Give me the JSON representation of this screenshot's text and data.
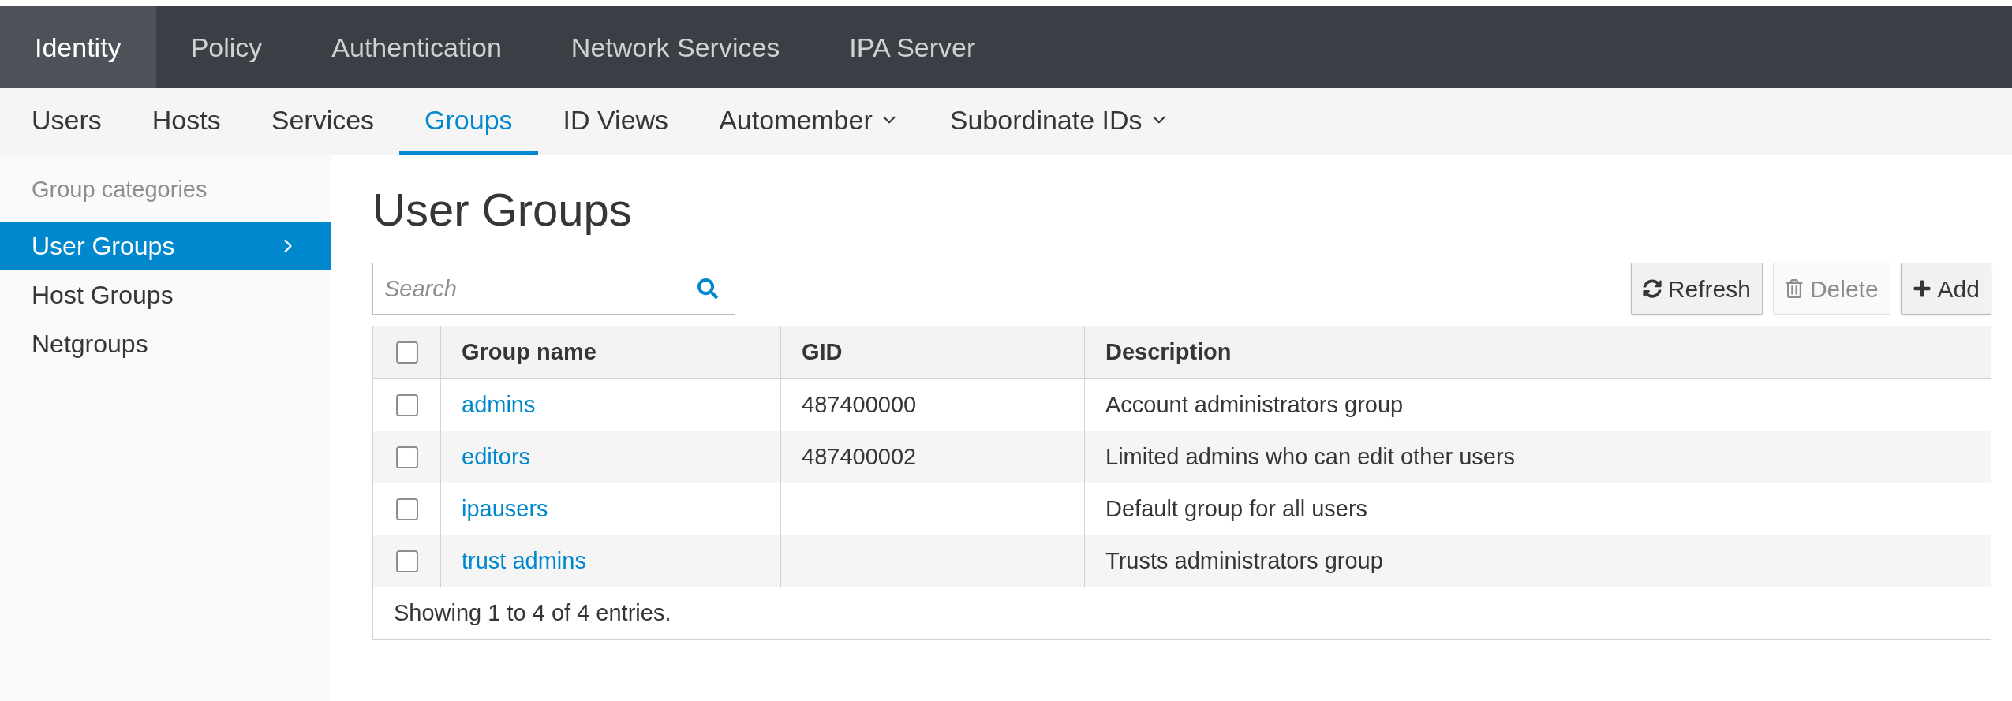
{
  "top_nav": [
    {
      "label": "Identity",
      "selected": true
    },
    {
      "label": "Policy",
      "selected": false
    },
    {
      "label": "Authentication",
      "selected": false
    },
    {
      "label": "Network Services",
      "selected": false
    },
    {
      "label": "IPA Server",
      "selected": false
    }
  ],
  "sub_nav": [
    {
      "label": "Users",
      "selected": false,
      "dropdown": false
    },
    {
      "label": "Hosts",
      "selected": false,
      "dropdown": false
    },
    {
      "label": "Services",
      "selected": false,
      "dropdown": false
    },
    {
      "label": "Groups",
      "selected": true,
      "dropdown": false
    },
    {
      "label": "ID Views",
      "selected": false,
      "dropdown": false
    },
    {
      "label": "Automember",
      "selected": false,
      "dropdown": true
    },
    {
      "label": "Subordinate IDs",
      "selected": false,
      "dropdown": true
    }
  ],
  "sidebar": {
    "heading": "Group categories",
    "items": [
      {
        "label": "User Groups",
        "selected": true
      },
      {
        "label": "Host Groups",
        "selected": false
      },
      {
        "label": "Netgroups",
        "selected": false
      }
    ]
  },
  "page_title": "User Groups",
  "search": {
    "placeholder": "Search"
  },
  "buttons": [
    {
      "kind": "refresh",
      "label": "Refresh",
      "disabled": false
    },
    {
      "kind": "delete",
      "label": "Delete",
      "disabled": true
    },
    {
      "kind": "add",
      "label": "Add",
      "disabled": false
    }
  ],
  "table": {
    "select_all_checked": false,
    "columns": [
      "Group name",
      "GID",
      "Description"
    ],
    "rows": [
      {
        "checked": false,
        "name": "admins",
        "gid": "487400000",
        "description": "Account administrators group"
      },
      {
        "checked": false,
        "name": "editors",
        "gid": "487400002",
        "description": "Limited admins who can edit other users"
      },
      {
        "checked": false,
        "name": "ipausers",
        "description": "Default group for all users"
      },
      {
        "checked": false,
        "name": "trust admins",
        "description": "Trusts administrators group"
      }
    ],
    "footer": "Showing 1 to 4 of 4 entries."
  }
}
